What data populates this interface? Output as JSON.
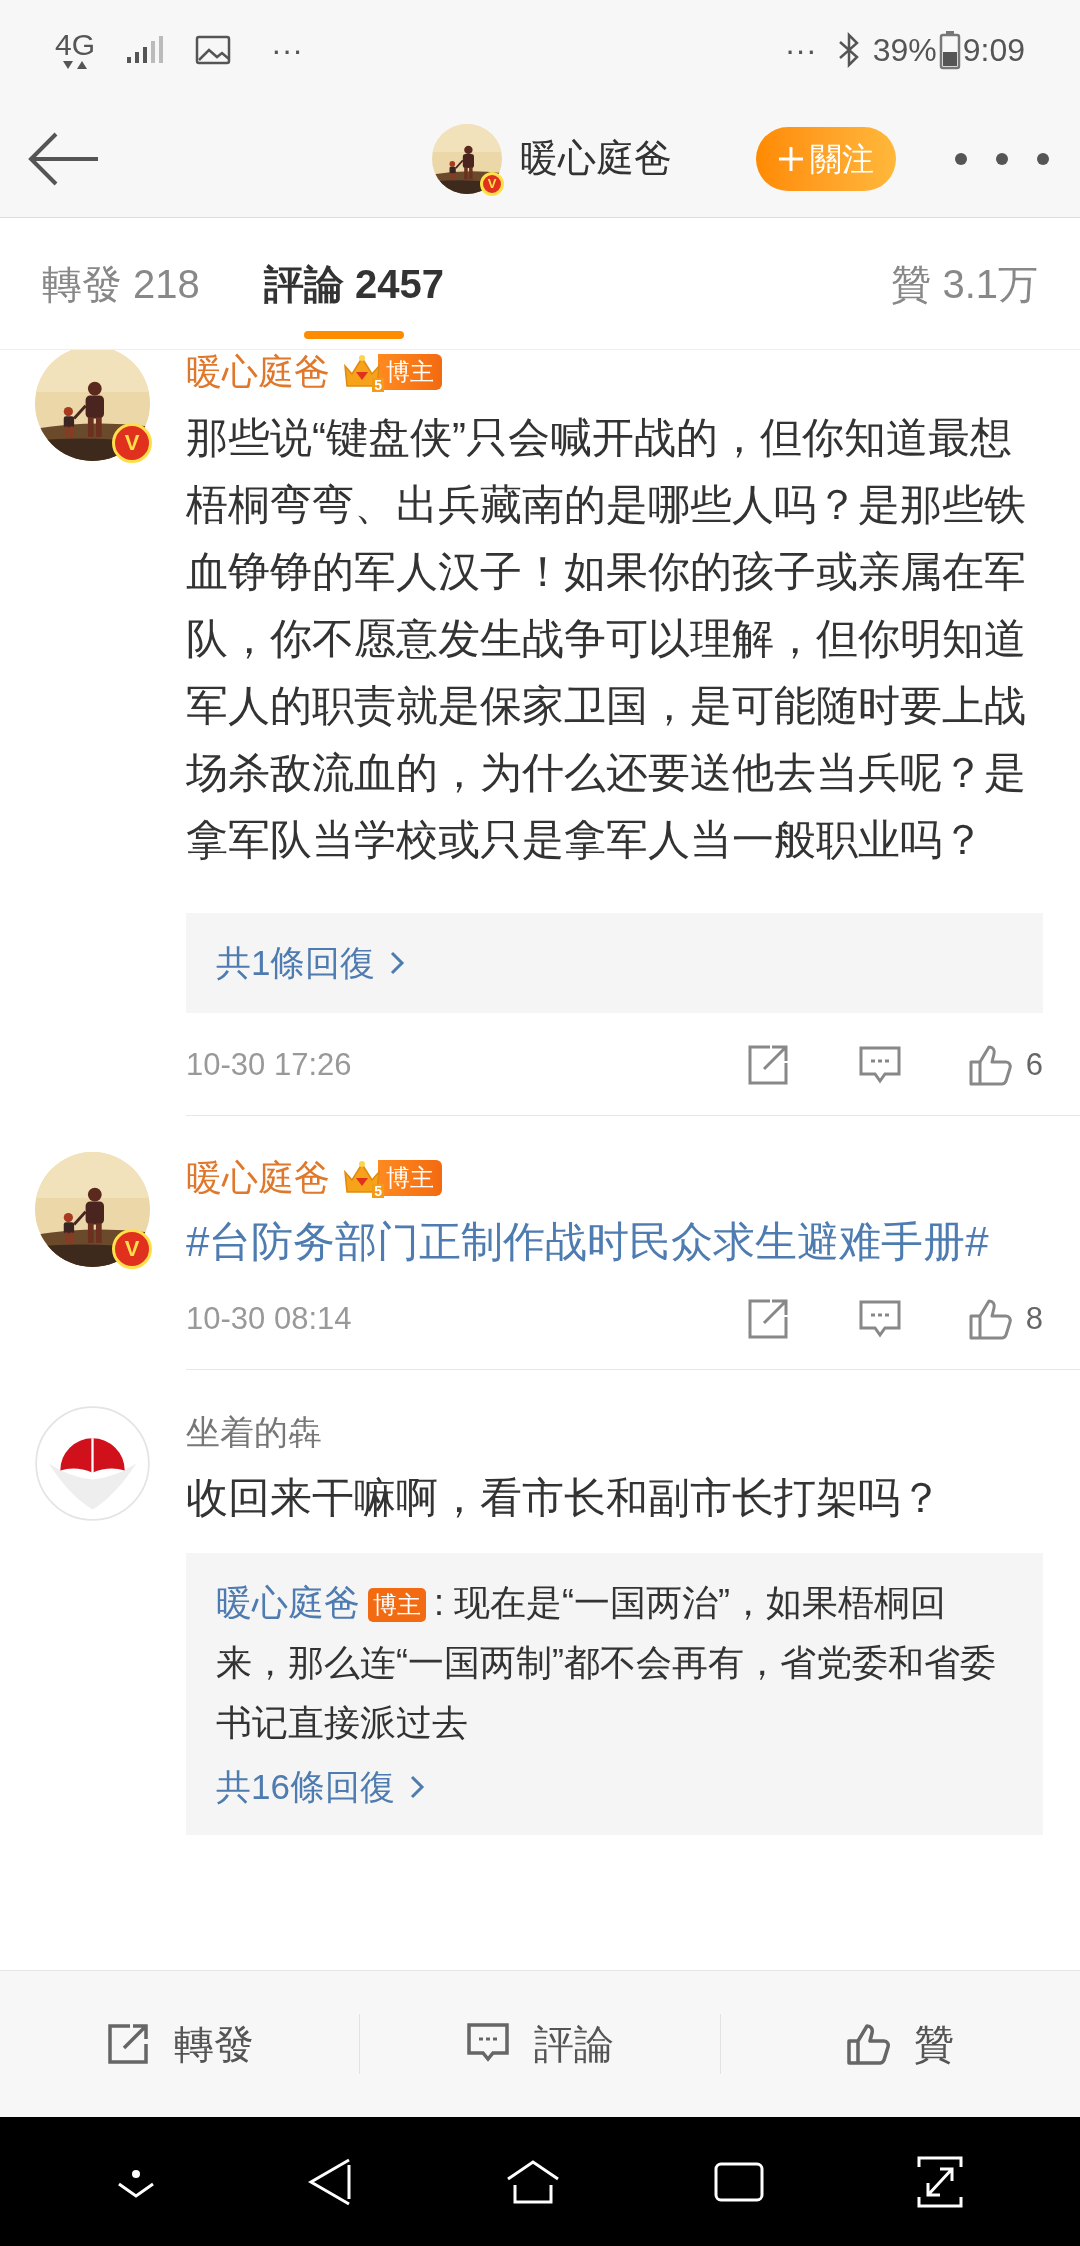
{
  "status_bar": {
    "network": "4G",
    "left_more": "···",
    "right_more": "···",
    "battery_text": "39%",
    "time": "9:09"
  },
  "header": {
    "title": "暖心庭爸",
    "verified_mark": "V",
    "follow_button": "關注"
  },
  "tabs": [
    {
      "label": "轉發 218",
      "selected": false
    },
    {
      "label": "評論 2457",
      "selected": true
    },
    {
      "label": "贊 3.1万",
      "selected": false
    }
  ],
  "comments": [
    {
      "kind": "blogger",
      "author": "暖心庭爸",
      "verified_mark": "V",
      "rank": "5",
      "badge": "博主",
      "body": {
        "kind": "plain",
        "text": "那些说“键盘侠”只会喊开战的，但你知道最想梧桐弯弯、出兵藏南的是哪些人吗？是那些铁血铮铮的军人汉子！如果你的孩子或亲属在军队，你不愿意发生战争可以理解，但你明知道军人的职责就是保家卫国，是可能随时要上战场杀敌流血的，为什么还要送他去当兵呢？是拿军队当学校或只是拿军人当一般职业吗？"
      },
      "replies_link": "共1條回復",
      "time": "10-30 17:26",
      "likes": "6"
    },
    {
      "kind": "blogger",
      "author": "暖心庭爸",
      "verified_mark": "V",
      "rank": "5",
      "badge": "博主",
      "body": {
        "kind": "hashtag",
        "text": "#台防务部门正制作战时民众求生避难手册#"
      },
      "time": "10-30 08:14",
      "likes": "8"
    },
    {
      "kind": "user",
      "author": "坐着的犇",
      "body": {
        "kind": "plain",
        "text": "收回来干嘛啊，看市长和副市长打架吗？"
      },
      "reply_preview": {
        "author": "暖心庭爸",
        "badge": "博主",
        "text": ": 现在是“一国两治”，如果梧桐回来，那么连“一国两制”都不会再有，省党委和省委书记直接派过去"
      },
      "replies_link": "共16條回復"
    }
  ],
  "action_bar": [
    {
      "kind": "repost",
      "label": "轉發"
    },
    {
      "kind": "comment",
      "label": "評論"
    },
    {
      "kind": "like",
      "label": "贊"
    }
  ]
}
